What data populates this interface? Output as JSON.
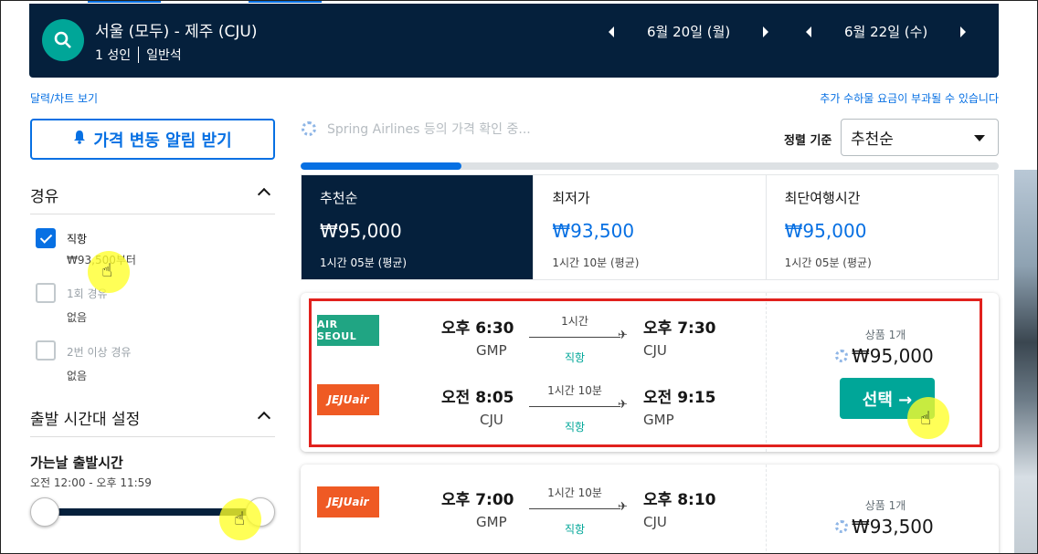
{
  "header": {
    "route": "서울 (모두) - 제주 (CJU)",
    "passengers": "1 성인",
    "cabin": "일반석",
    "depart_date": "6월 20일 (월)",
    "return_date": "6월 22일 (수)"
  },
  "links": {
    "calendar": "달력/차트 보기",
    "baggage_notice": "추가 수하물 요금이 부과될 수 있습니다"
  },
  "sidebar": {
    "price_alert": "가격 변동 알림 받기",
    "stops_title": "경유",
    "stops": [
      {
        "label": "직항",
        "sub": "₩93,500부터",
        "checked": true
      },
      {
        "label": "1회 경유",
        "sub": "없음",
        "checked": false
      },
      {
        "label": "2번 이상 경유",
        "sub": "없음",
        "checked": false
      }
    ],
    "time_title": "출발 시간대 설정",
    "outbound_title": "가는날 출발시간",
    "outbound_range": "오전 12:00 - 오후 11:59",
    "slider": {
      "min": 0,
      "max": 1
    }
  },
  "loading_text": "Spring Airlines 등의 가격 확인 중...",
  "sort": {
    "label": "정렬 기준",
    "value": "추천순"
  },
  "progress": 0.23,
  "tabs": [
    {
      "name": "추천순",
      "price": "₩95,000",
      "duration": "1시간 05분 (평균)",
      "active": true
    },
    {
      "name": "최저가",
      "price": "₩93,500",
      "duration": "1시간 10분 (평균)",
      "active": false
    },
    {
      "name": "최단여행시간",
      "price": "₩95,000",
      "duration": "1시간 05분 (평균)",
      "active": false
    }
  ],
  "results": [
    {
      "legs": [
        {
          "airline": "AIR SEOUL",
          "dep_time": "오후 6:30",
          "dep_ap": "GMP",
          "duration": "1시간",
          "stops": "직항",
          "arr_time": "오후 7:30",
          "arr_ap": "CJU"
        },
        {
          "airline": "JEJUair",
          "dep_time": "오전 8:05",
          "dep_ap": "CJU",
          "duration": "1시간 10분",
          "stops": "직항",
          "arr_time": "오전 9:15",
          "arr_ap": "GMP"
        }
      ],
      "deals": "상품 1개",
      "price": "₩95,000",
      "select": "선택 →"
    },
    {
      "legs": [
        {
          "airline": "JEJUair",
          "dep_time": "오후 7:00",
          "dep_ap": "GMP",
          "duration": "1시간 10분",
          "stops": "직항",
          "arr_time": "오후 8:10",
          "arr_ap": "CJU"
        }
      ],
      "deals": "상품 1개",
      "price": "₩93,500"
    }
  ],
  "colors": {
    "navy": "#05203c",
    "accent_blue": "#0770e3",
    "teal": "#00a698",
    "highlight_red": "#e1211d"
  }
}
